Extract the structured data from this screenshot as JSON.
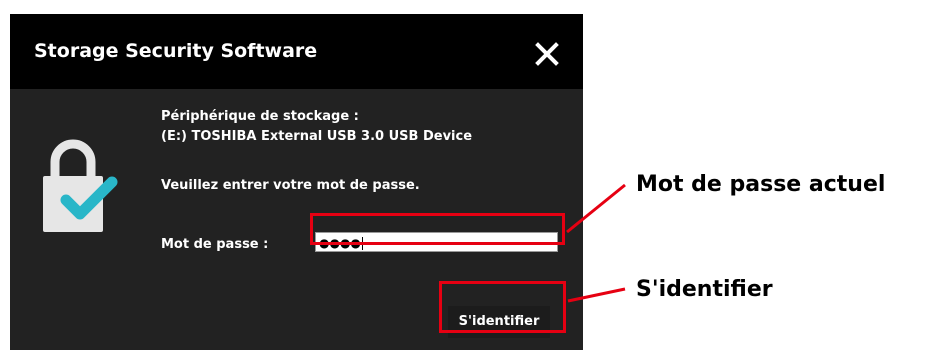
{
  "window": {
    "title": "Storage Security Software"
  },
  "device": {
    "label": "Périphérique de stockage :",
    "name": "(E:) TOSHIBA External USB 3.0 USB Device"
  },
  "prompt": "Veuillez entrer votre mot de passe.",
  "password": {
    "label": "Mot de passe :",
    "value": "●●●●"
  },
  "login_button": "S'identifier",
  "annotations": {
    "password_callout": "Mot de passe actuel",
    "login_callout": "S'identifier"
  },
  "colors": {
    "titlebar": "#000000",
    "window": "#222222",
    "accent_check": "#29b6c8",
    "lock": "#e6e6e6",
    "callout_red": "#e60012"
  },
  "icons": [
    "close-icon",
    "lock-check-icon"
  ]
}
